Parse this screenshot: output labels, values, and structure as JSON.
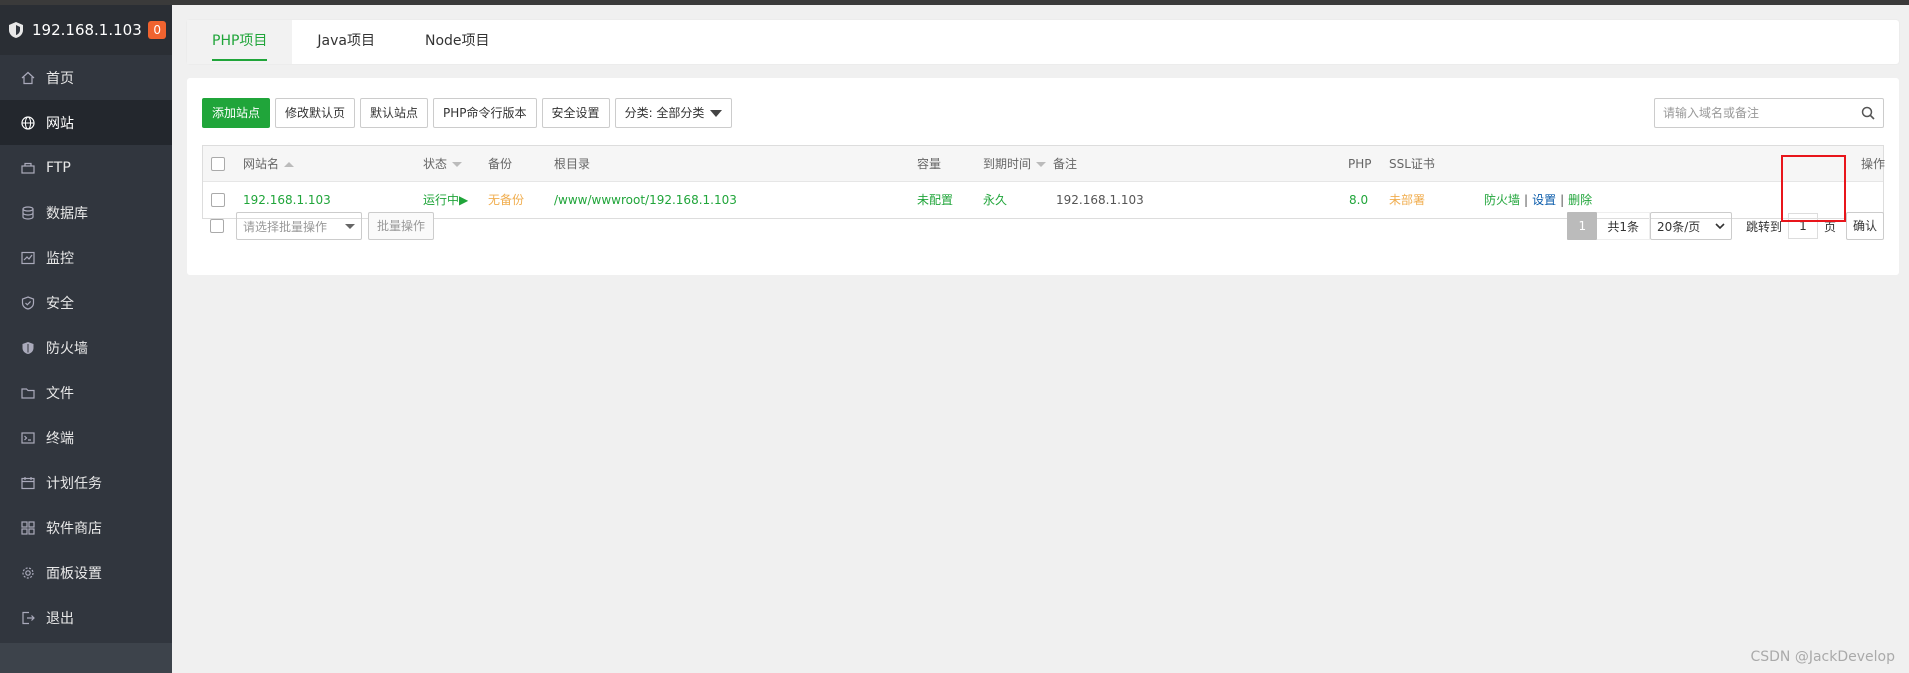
{
  "brand": {
    "host": "192.168.1.103",
    "badge": "0"
  },
  "sidebar": {
    "items": [
      {
        "label": "首页",
        "icon": "home-icon"
      },
      {
        "label": "网站",
        "icon": "globe-icon"
      },
      {
        "label": "FTP",
        "icon": "ftp-icon"
      },
      {
        "label": "数据库",
        "icon": "database-icon"
      },
      {
        "label": "监控",
        "icon": "monitor-icon"
      },
      {
        "label": "安全",
        "icon": "shield-check-icon"
      },
      {
        "label": "防火墙",
        "icon": "firewall-icon"
      },
      {
        "label": "文件",
        "icon": "folder-icon"
      },
      {
        "label": "终端",
        "icon": "terminal-icon"
      },
      {
        "label": "计划任务",
        "icon": "calendar-icon"
      },
      {
        "label": "软件商店",
        "icon": "apps-icon"
      },
      {
        "label": "面板设置",
        "icon": "gear-icon"
      },
      {
        "label": "退出",
        "icon": "logout-icon"
      }
    ],
    "active_index": 1
  },
  "tabs": [
    {
      "label": "PHP项目"
    },
    {
      "label": "Java项目"
    },
    {
      "label": "Node项目"
    }
  ],
  "toolbar": {
    "add_site": "添加站点",
    "edit_default_page": "修改默认页",
    "default_site": "默认站点",
    "php_cli_version": "PHP命令行版本",
    "security_settings": "安全设置",
    "category": "分类: 全部分类"
  },
  "search": {
    "placeholder": "请输入域名或备注"
  },
  "table": {
    "headers": {
      "site_name": "网站名",
      "status": "状态",
      "backup": "备份",
      "root_dir": "根目录",
      "capacity": "容量",
      "expire": "到期时间",
      "remark": "备注",
      "php": "PHP",
      "ssl": "SSL证书",
      "actions": "操作"
    },
    "rows": [
      {
        "site_name": "192.168.1.103",
        "status": "运行中▶",
        "backup": "无备份",
        "root_dir": "/www/wwwroot/192.168.1.103",
        "capacity": "未配置",
        "expire": "永久",
        "remark": "192.168.1.103",
        "php": "8.0",
        "ssl": "未部署",
        "action_firewall": "防火墙",
        "action_settings": "设置",
        "action_delete": "删除",
        "separator": "|"
      }
    ]
  },
  "batch": {
    "select_placeholder": "请选择批量操作",
    "button": "批量操作"
  },
  "pager": {
    "current_page": "1",
    "total": "共1条",
    "page_size": "20条/页",
    "jump_label": "跳转到",
    "jump_value": "1",
    "page_unit": "页",
    "confirm": "确认"
  },
  "watermark": "CSDN @JackDevelop",
  "colors": {
    "accent_green": "#20a53a",
    "warning_orange": "#f0ad4e",
    "sidebar_bg": "#31363e",
    "badge_orange": "#f0632f",
    "highlight_red": "#e8151b"
  }
}
